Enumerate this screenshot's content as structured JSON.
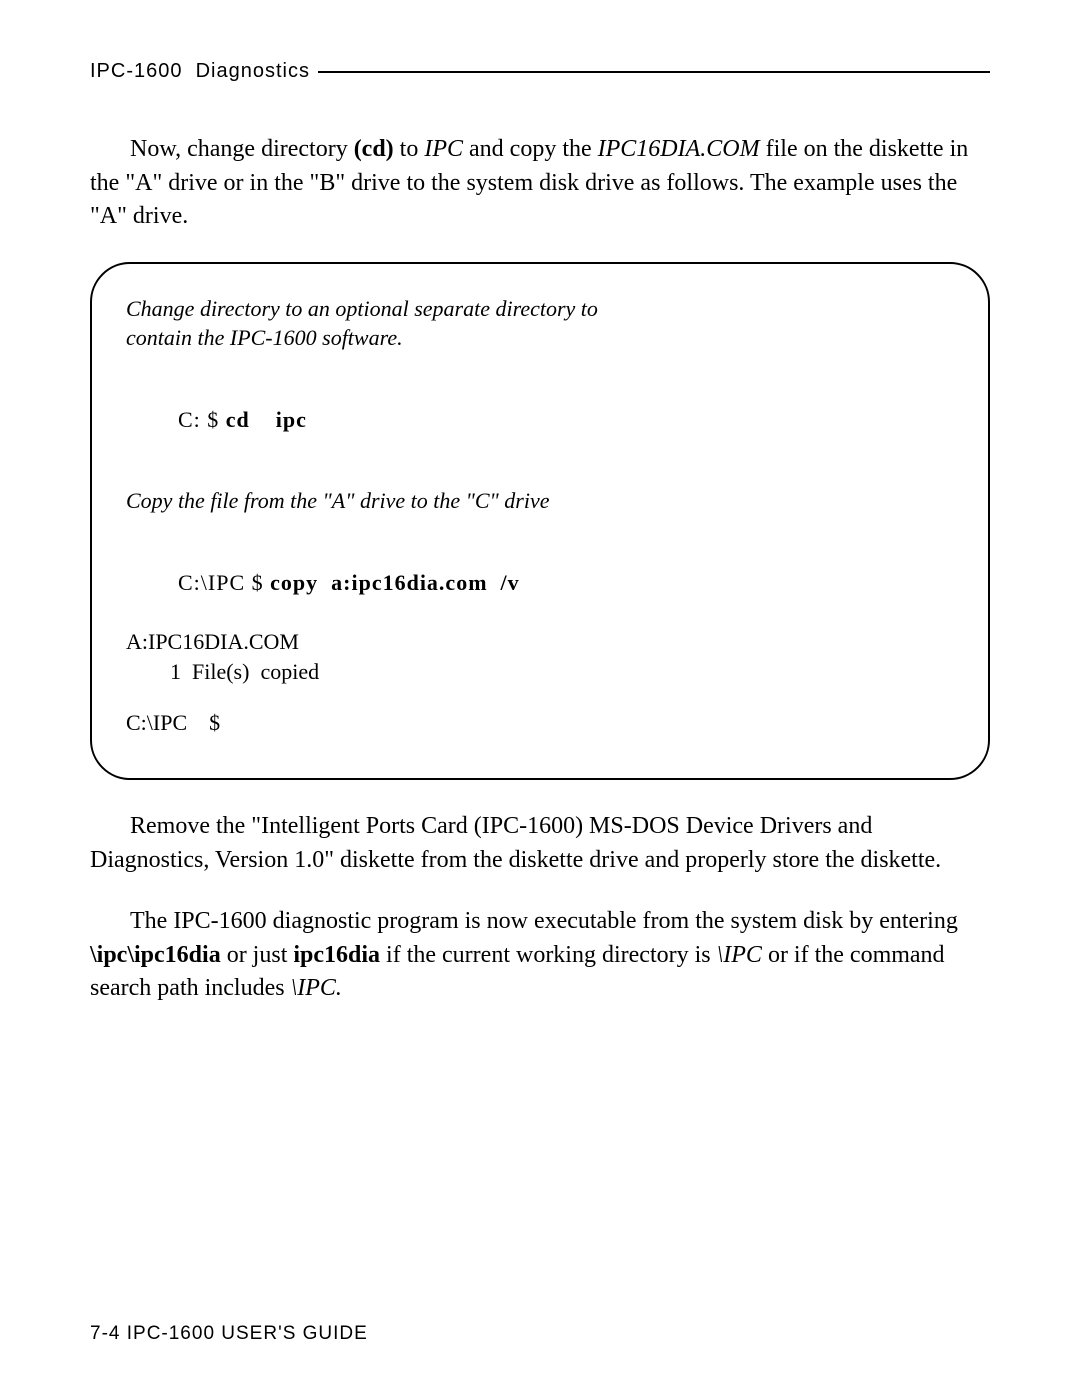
{
  "header": {
    "title": "IPC-1600  Diagnostics"
  },
  "para1": {
    "lead": "Now, change directory ",
    "cd": "(cd)",
    "to": " to ",
    "ipc": "IPC",
    "mid": " and copy the ",
    "file": "IPC16DIA.COM",
    "tail": " file on the diskette in the \"A\" drive or in the \"B\" drive to the system disk drive as follows. The example uses the \"A\" drive."
  },
  "terminal": {
    "note1_l1": "Change directory to an optional separate directory to",
    "note1_l2": "contain the IPC-1600 software.",
    "prompt1_pre": "C: $ ",
    "prompt1_cmd": "cd    ipc",
    "note2": "Copy the file from the \"A\" drive to the \"C\" drive",
    "prompt2_pre": "C:\\IPC $ ",
    "prompt2_cmd": "copy  a:ipc16dia.com  /v",
    "out1": "A:IPC16DIA.COM",
    "out2": "        1  File(s)  copied",
    "prompt3": "C:\\IPC    $"
  },
  "para2": {
    "text": "Remove the \"Intelligent Ports Card (IPC-1600) MS-DOS Device Drivers and Diagnostics, Version 1.0\" diskette from the diskette drive and properly store the diskette."
  },
  "para3": {
    "a": "The IPC-1600 diagnostic program is now executable from the system disk by entering ",
    "b": "\\ipc\\ipc16dia",
    "c": " or just ",
    "d": "ipc16dia",
    "e": " if the current working directory is ",
    "f": "\\IPC",
    "g": " or if the command search path includes ",
    "h": "\\IPC.",
    "i": ""
  },
  "footer": {
    "text": "7-4   IPC-1600 USER'S GUIDE"
  }
}
